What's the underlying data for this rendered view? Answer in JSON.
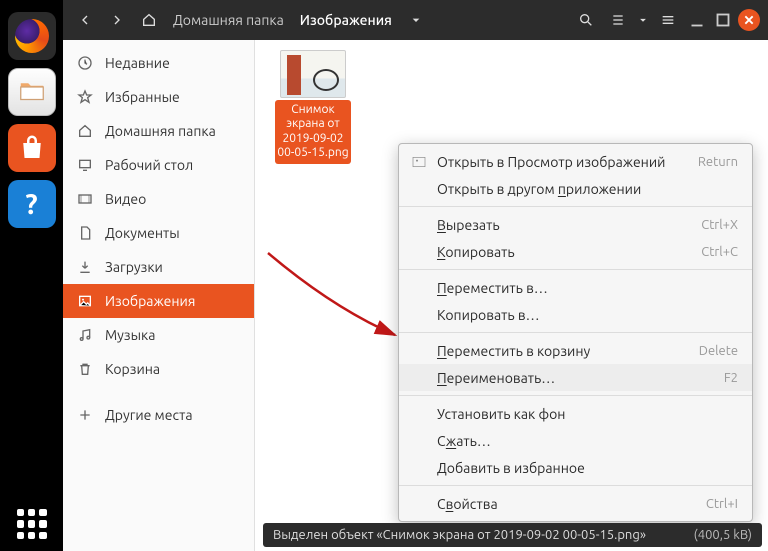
{
  "dock": {
    "apps": [
      "firefox",
      "files",
      "software",
      "help"
    ]
  },
  "titlebar": {
    "home_label": "Домашняя папка",
    "current_folder": "Изображения"
  },
  "sidebar": {
    "items": [
      {
        "label": "Недавние"
      },
      {
        "label": "Избранные"
      },
      {
        "label": "Домашняя папка"
      },
      {
        "label": "Рабочий стол"
      },
      {
        "label": "Видео"
      },
      {
        "label": "Документы"
      },
      {
        "label": "Загрузки"
      },
      {
        "label": "Изображения"
      },
      {
        "label": "Музыка"
      },
      {
        "label": "Корзина"
      },
      {
        "label": "Другие места"
      }
    ],
    "active_index": 7
  },
  "file": {
    "label": "Снимок экрана от 2019-09-02 00-05-15.png"
  },
  "context_menu": {
    "items": [
      {
        "label": "Открыть в Просмотр изображений",
        "accel": "Return",
        "icon": true
      },
      {
        "label": "Открыть в другом приложении"
      },
      {
        "sep": true
      },
      {
        "label": "Вырезать",
        "accel": "Ctrl+X"
      },
      {
        "label": "Копировать",
        "accel": "Ctrl+C"
      },
      {
        "sep": true
      },
      {
        "label": "Переместить в…"
      },
      {
        "label": "Копировать в…"
      },
      {
        "sep": true
      },
      {
        "label": "Переместить в корзину",
        "accel": "Delete"
      },
      {
        "label": "Переименовать…",
        "accel": "F2",
        "highlight": true
      },
      {
        "sep": true
      },
      {
        "label": "Установить как фон"
      },
      {
        "label": "Сжать…"
      },
      {
        "label": "Добавить в избранное"
      },
      {
        "sep": true
      },
      {
        "label": "Свойства",
        "accel": "Ctrl+I"
      }
    ]
  },
  "statusbar": {
    "text": "Выделен объект «Снимок экрана от 2019-09-02 00-05-15.png»",
    "size": "(400,5 kB)"
  }
}
